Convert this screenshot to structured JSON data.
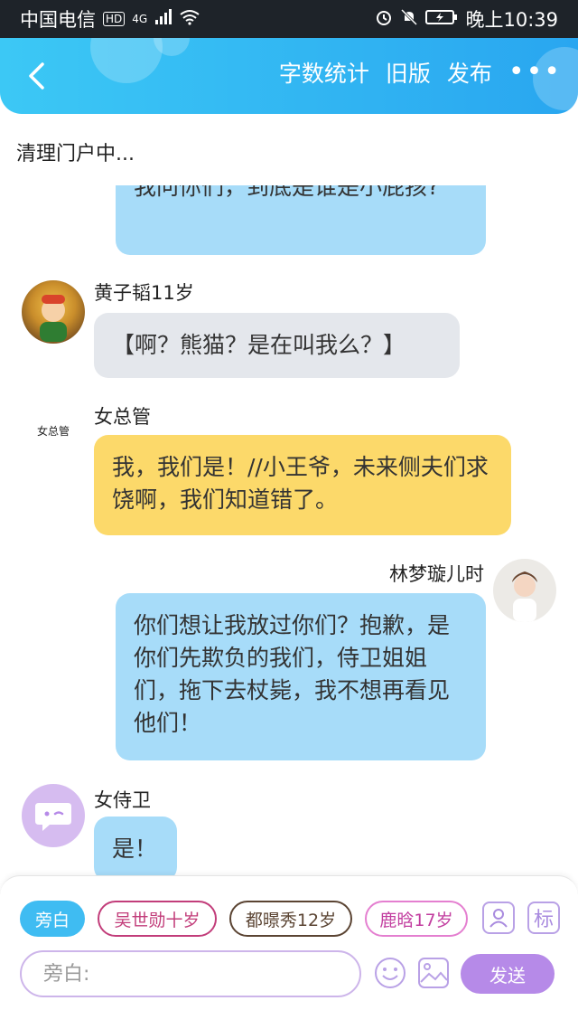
{
  "status_bar": {
    "carrier": "中国电信",
    "hd": "HD",
    "network": "4G",
    "time": "晚上10:39"
  },
  "header": {
    "word_count": "字数统计",
    "old_version": "旧版",
    "publish": "发布",
    "more": "•••"
  },
  "subtitle": "清理门户中...",
  "messages": [
    {
      "name": "",
      "text": "我问你们，到底是谁是小屁孩?"
    },
    {
      "name": "黄子韬11岁",
      "text": "【啊？熊猫？是在叫我么？】"
    },
    {
      "name": "女总管",
      "avatar_text": "女总管",
      "text": "我，我们是！//小王爷，未来侧夫们求饶啊，我们知道错了。"
    },
    {
      "name": "林梦璇儿时",
      "text": "你们想让我放过你们？抱歉，是你们先欺负的我们，侍卫姐姐们，拖下去杖毙，我不想再看见他们！"
    },
    {
      "name": "女侍卫",
      "text": "是！"
    }
  ],
  "bottom": {
    "chips": [
      "旁白",
      "吴世勋十岁",
      "都暻秀12岁",
      "鹿晗17岁"
    ],
    "mark_label": "标",
    "input_placeholder": "旁白:",
    "send": "发送"
  },
  "colors": {
    "accent_blue": "#29a6f0",
    "bubble_blue": "#a7dcf9",
    "bubble_yellow": "#fcd96a",
    "send_purple": "#b68ae8"
  }
}
